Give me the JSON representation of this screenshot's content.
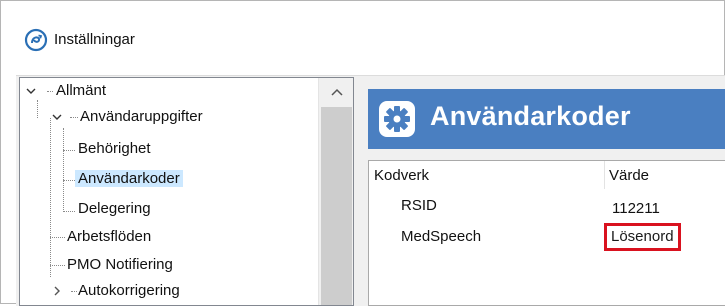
{
  "window": {
    "title": "Inställningar"
  },
  "tree": {
    "items": [
      {
        "label": "Allmänt",
        "expanded": true
      },
      {
        "label": "Användaruppgifter",
        "expanded": true
      },
      {
        "label": "Behörighet"
      },
      {
        "label": "Användarkoder",
        "selected": true
      },
      {
        "label": "Delegering"
      },
      {
        "label": "Arbetsflöden"
      },
      {
        "label": "PMO Notifiering"
      },
      {
        "label": "Autokorrigering",
        "expanded": false
      }
    ]
  },
  "panel": {
    "title": "Användarkoder",
    "icon": "gear-icon",
    "columns": [
      "Kodverk",
      "Värde"
    ],
    "rows": [
      {
        "kodverk": "RSID",
        "varde": "112211"
      },
      {
        "kodverk": "MedSpeech",
        "varde": "Lösenord"
      }
    ]
  },
  "colors": {
    "banner": "#4a7fc1",
    "selection": "#cce8ff",
    "highlight": "#d9121f"
  }
}
